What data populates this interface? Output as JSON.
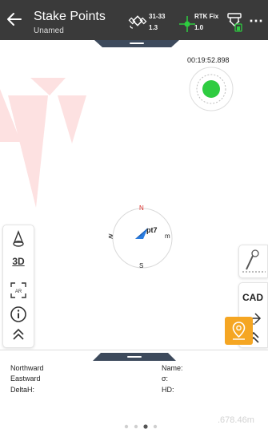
{
  "header": {
    "title": "Stake Points",
    "subtitle": "Unamed",
    "satellites": "31-33",
    "satellite_value": "1.3",
    "rtk_status": "RTK Fix",
    "rtk_value": "1.0",
    "more_label": "⋯"
  },
  "map": {
    "timer": "00:19:52.898",
    "compass": {
      "north": "N",
      "south": "S",
      "west": "≷",
      "east": "m"
    },
    "point_label": "pt7"
  },
  "left_toolbar": {
    "view_3d_label": "3D"
  },
  "right_toolbar": {
    "cad_label": "CAD"
  },
  "bottom_panel": {
    "northward_label": "Northward",
    "eastward_label": "Eastward",
    "delta_h_label": "DeltaH:",
    "name_label": "Name:",
    "sigma_label": "σ:",
    "hd_label": "HD:",
    "distance": ".678.46m"
  },
  "colors": {
    "header_bg": "#3a3a3a",
    "accent_green": "#2ecc40",
    "stake_orange": "#f5a623",
    "north_red": "#d9302b"
  }
}
